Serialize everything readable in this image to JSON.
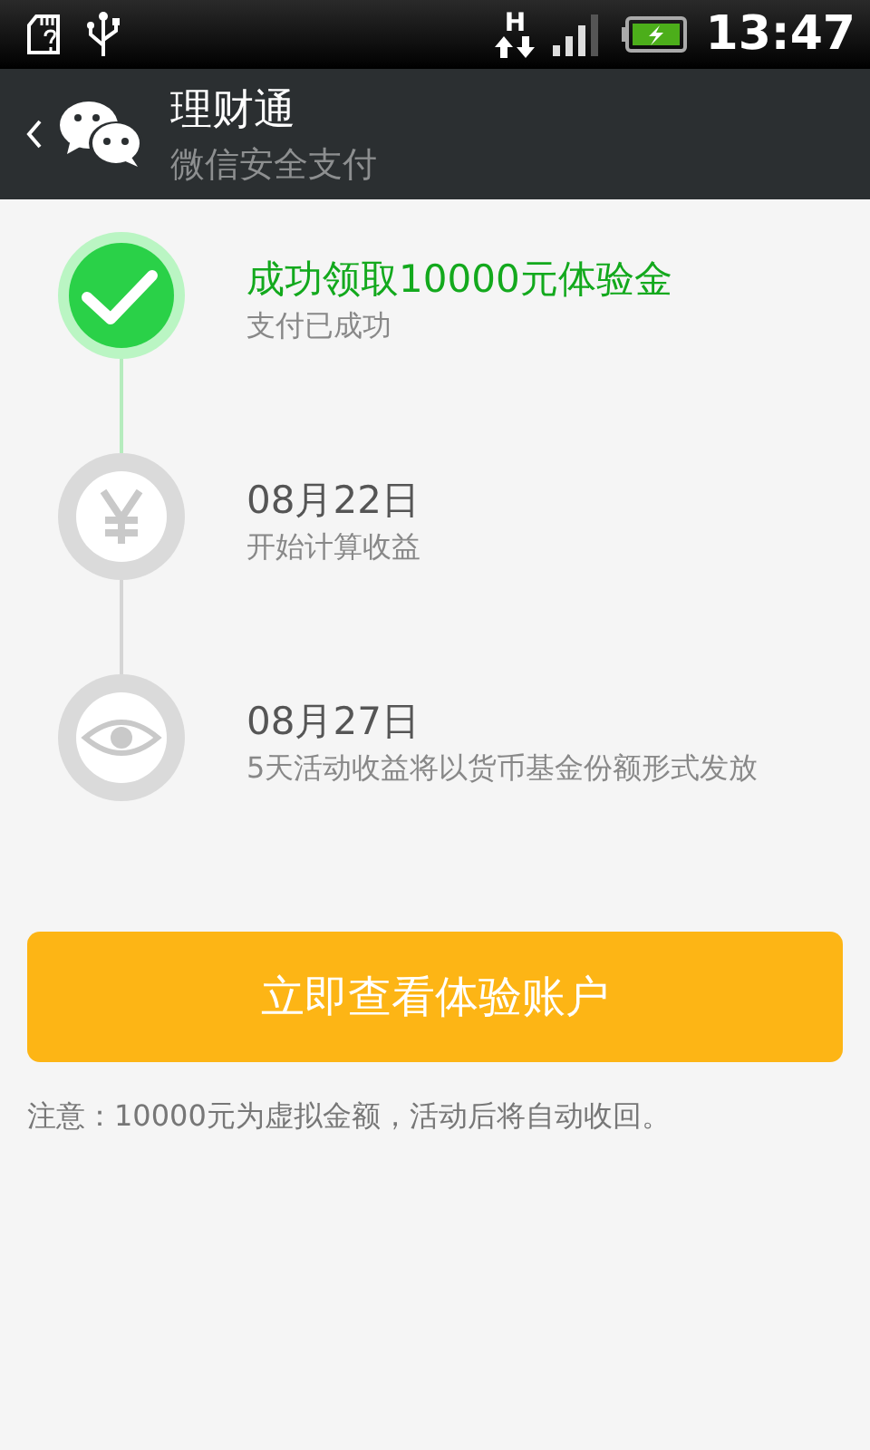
{
  "status_bar": {
    "network_type": "H",
    "time": "13:47"
  },
  "header": {
    "title": "理财通",
    "subtitle": "微信安全支付"
  },
  "steps": [
    {
      "kind": "check",
      "done": true,
      "title": "成功领取10000元体验金",
      "subtitle": "支付已成功"
    },
    {
      "kind": "yen",
      "done": false,
      "title": "08月22日",
      "subtitle": "开始计算收益"
    },
    {
      "kind": "eye",
      "done": false,
      "title": "08月27日",
      "subtitle": "5天活动收益将以货币基金份额形式发放"
    }
  ],
  "button": {
    "label": "立即查看体验账户"
  },
  "note": "注意：10000元为虚拟金额，活动后将自动收回。"
}
